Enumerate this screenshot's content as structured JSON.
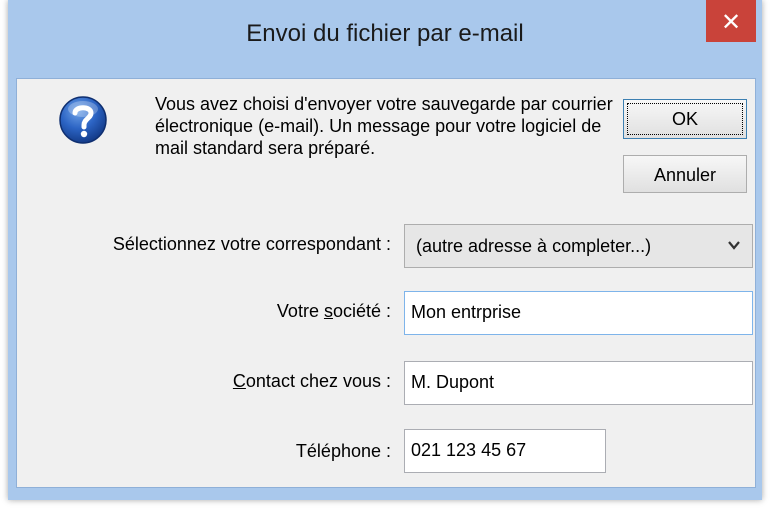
{
  "window": {
    "title": "Envoi du fichier par e-mail",
    "close_glyph": "✕"
  },
  "message": {
    "icon": "question-icon",
    "text": "Vous avez choisi d'envoyer votre sauvegarde par courrier électronique (e-mail). Un message pour votre logiciel de mail standard sera préparé."
  },
  "buttons": {
    "ok_label": "OK",
    "cancel_label": "Annuler"
  },
  "form": {
    "correspondent": {
      "label": "Sélectionnez votre correspondant :",
      "selected": "(autre adresse à completer...)"
    },
    "company": {
      "label_prefix": "Votre ",
      "label_underlined": "s",
      "label_suffix": "ociété :",
      "value": "Mon entrprise"
    },
    "contact": {
      "label_underlined": "C",
      "label_suffix": "ontact chez vous :",
      "value": "M. Dupont"
    },
    "phone": {
      "label": "Téléphone :",
      "value": "021 123 45 67"
    }
  },
  "colors": {
    "frame": "#a9c8ec",
    "close": "#c9433a",
    "client": "#f0f0f0"
  }
}
